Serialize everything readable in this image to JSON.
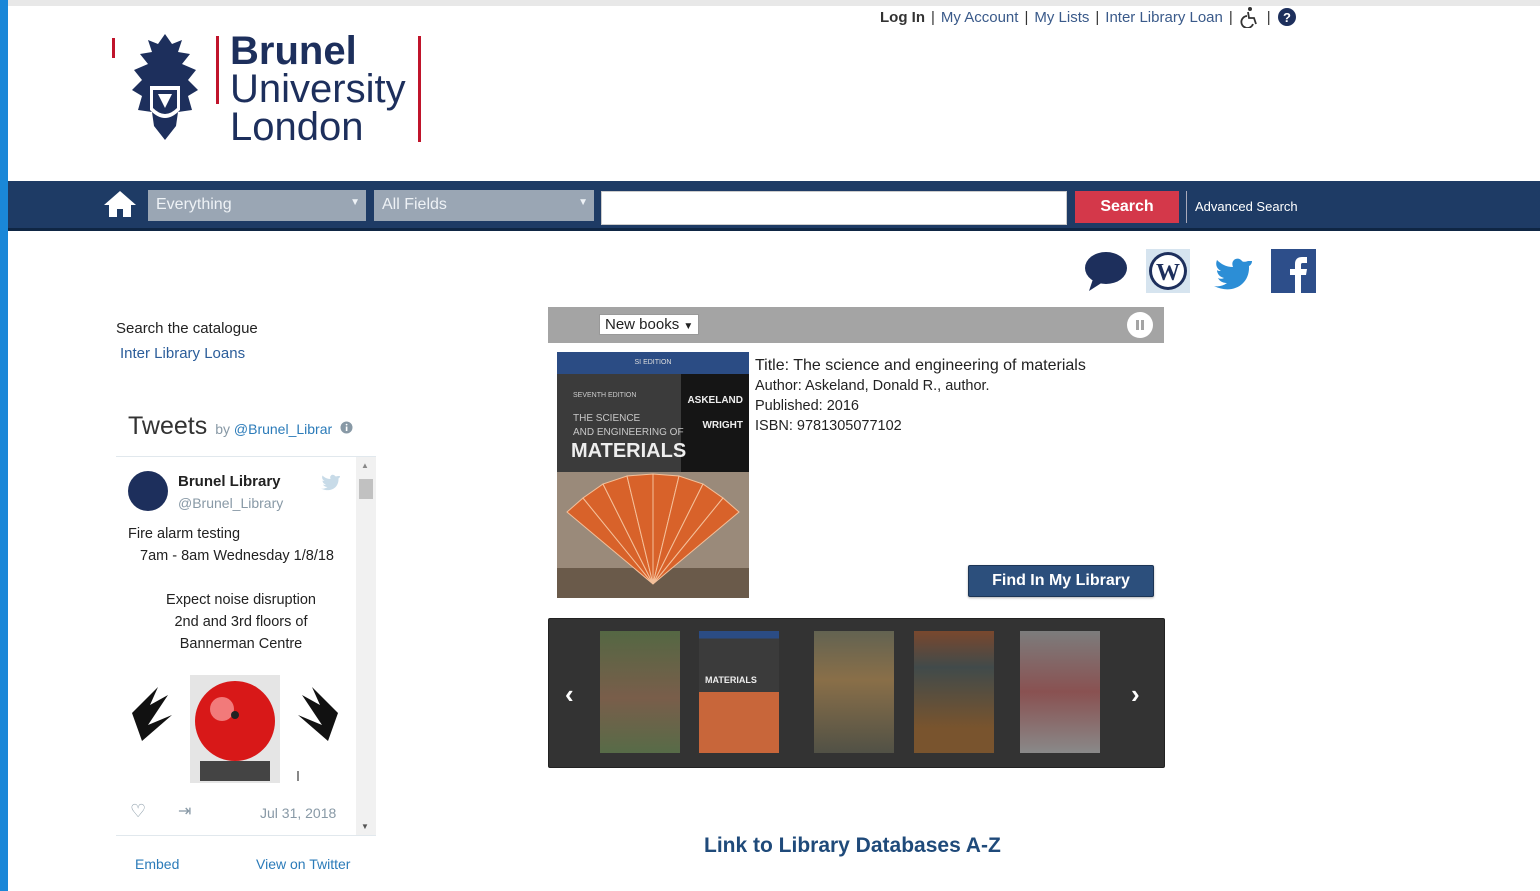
{
  "top_nav": {
    "login": "Log In",
    "account": "My Account",
    "lists": "My Lists",
    "ill": "Inter Library Loan",
    "sep": "|"
  },
  "logo": {
    "line1": "Brunel",
    "line2": "University",
    "line3": "London"
  },
  "search": {
    "scope": "Everything",
    "field": "All Fields",
    "query": "",
    "button": "Search",
    "advanced": "Advanced Search"
  },
  "sidebar": {
    "search_catalogue": "Search the catalogue",
    "inter_library": "Inter Library Loans"
  },
  "tweets": {
    "title": "Tweets",
    "by": "by",
    "handle_link": "@Brunel_Librar",
    "tweet": {
      "name": "Brunel Library",
      "handle": "@Brunel_Library",
      "line1": "Fire alarm testing",
      "line2": "7am - 8am Wednesday 1/8/18",
      "line3": "Expect noise disruption",
      "line4": "2nd and 3rd floors of",
      "line5": "Bannerman Centre",
      "date": "Jul 31, 2018"
    },
    "embed": "Embed",
    "view": "View on Twitter"
  },
  "new_books": {
    "dropdown": "New books",
    "book": {
      "title": "Title: The science and engineering of materials",
      "author": "Author: Askeland, Donald R., author.",
      "published": "Published: 2016",
      "isbn": "ISBN: 9781305077102",
      "cover_edition": "SI EDITION",
      "cover_seventh": "SEVENTH EDITION",
      "cover_title1": "THE SCIENCE",
      "cover_title2": "AND ENGINEERING OF",
      "cover_title3": "MATERIALS",
      "cover_author1": "ASKELAND",
      "cover_author2": "WRIGHT"
    },
    "find_button": "Find In My Library"
  },
  "databases_link": "Link to Library Databases A-Z",
  "colors": {
    "navbar": "#1e3b65",
    "search_button": "#d4384a",
    "brand_red": "#c0142b",
    "brand_blue": "#1d2f5c"
  }
}
